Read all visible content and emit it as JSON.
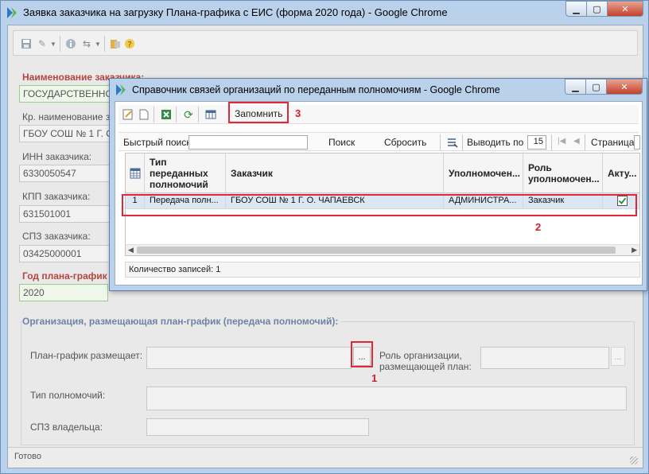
{
  "main_window": {
    "title": "Заявка заказчика на загрузку Плана-графика с ЕИС (форма 2020 года) - Google Chrome",
    "icons": [
      "app-logo-icon",
      "save-icon",
      "attach-icon",
      "info-icon",
      "workflow-icon",
      "export-icon",
      "help-icon"
    ],
    "labels": {
      "customer_name": "Наименование заказчика:",
      "short_name": "Кр. наименование за",
      "inn": "ИНН заказчика:",
      "kpp": "КПП заказчика:",
      "spz": "СПЗ заказчика:",
      "plan_year": "Год плана-график",
      "org_section": "Организация, размещающая план-график (передача полномочий):",
      "plan_placer": "План-график размещает:",
      "org_role_line1": "Роль организации,",
      "org_role_line2": "размещающей план:",
      "authority_type": "Тип полномочий:",
      "owner_spz": "СПЗ владельца:"
    },
    "values": {
      "customer_name": "ГОСУДАРСТВЕННОЕ",
      "short_name": "ГБОУ СОШ № 1 Г. О",
      "inn": "6330050547",
      "kpp": "631501001",
      "spz": "03425000001",
      "plan_year": "2020"
    },
    "dots_label": "...",
    "status": "Готово"
  },
  "dialog": {
    "title": "Справочник связей организаций по переданным полномочиям - Google Chrome",
    "remember_label": "Запомнить",
    "quick_search_label": "Быстрый поиск",
    "quick_search_value": "",
    "search_label": "Поиск",
    "reset_label": "Сбросить",
    "page_size_label": "Выводить по",
    "page_size_value": "15",
    "page_label": "Страница",
    "columns": {
      "type": "Тип переданных полномочий",
      "customer": "Заказчик",
      "authorized": "Уполномочен...",
      "role": "Роль уполномочен...",
      "active": "Акту..."
    },
    "rows": [
      {
        "num": "1",
        "type": "Передача полн...",
        "customer": "ГБОУ СОШ № 1 Г. О. ЧАПАЕВСК",
        "authorized": "АДМИНИСТРА...",
        "role": "Заказчик",
        "active": true
      }
    ],
    "records_count": "Количество записей: 1"
  },
  "annotations": {
    "n1": "1",
    "n2": "2",
    "n3": "3"
  },
  "colors": {
    "annotation_red": "#e0283a",
    "required_label": "#b7443d",
    "section_label": "#6e83a3",
    "row_selected": "#dde7f4"
  }
}
